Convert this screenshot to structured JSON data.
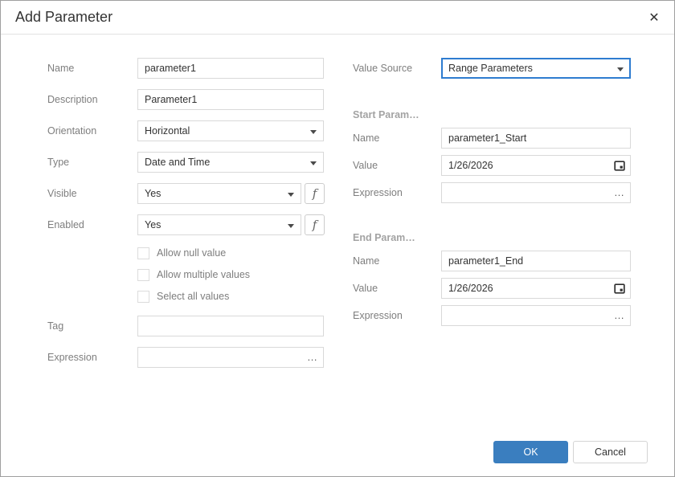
{
  "colors": {
    "accent": "#3a7ebf",
    "focus_border": "#2e7cd0"
  },
  "header": {
    "title": "Add Parameter",
    "close_icon": "✕"
  },
  "left": {
    "name": {
      "label": "Name",
      "value": "parameter1"
    },
    "description": {
      "label": "Description",
      "value": "Parameter1"
    },
    "orientation": {
      "label": "Orientation",
      "value": "Horizontal"
    },
    "type": {
      "label": "Type",
      "value": "Date and Time"
    },
    "visible": {
      "label": "Visible",
      "value": "Yes",
      "fx_glyph": "f"
    },
    "enabled": {
      "label": "Enabled",
      "value": "Yes",
      "fx_glyph": "f"
    },
    "checkboxes": [
      {
        "label": "Allow null value",
        "checked": false
      },
      {
        "label": "Allow multiple values",
        "checked": false
      },
      {
        "label": "Select all values",
        "checked": false
      }
    ],
    "tag": {
      "label": "Tag",
      "value": ""
    },
    "expression": {
      "label": "Expression",
      "value": "",
      "ellipsis_glyph": "…"
    }
  },
  "right": {
    "value_source": {
      "label": "Value Source",
      "value": "Range Parameters"
    },
    "start": {
      "header": "Start Param…",
      "name": {
        "label": "Name",
        "value": "parameter1_Start"
      },
      "value": {
        "label": "Value",
        "value": "1/26/2026"
      },
      "expression": {
        "label": "Expression",
        "value": "",
        "ellipsis_glyph": "…"
      }
    },
    "end": {
      "header": "End Param…",
      "name": {
        "label": "Name",
        "value": "parameter1_End"
      },
      "value": {
        "label": "Value",
        "value": "1/26/2026"
      },
      "expression": {
        "label": "Expression",
        "value": "",
        "ellipsis_glyph": "…"
      }
    }
  },
  "footer": {
    "ok_label": "OK",
    "cancel_label": "Cancel"
  }
}
